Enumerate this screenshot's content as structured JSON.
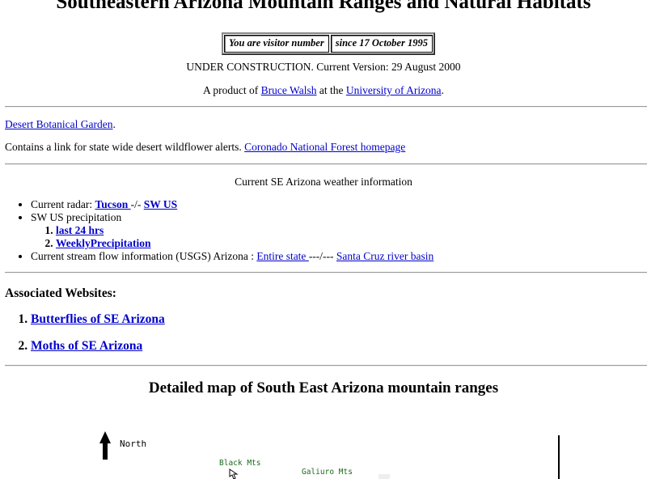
{
  "page": {
    "title": "Southeastern Arizona Mountain Ranges and Natural Habitats",
    "counter": {
      "left": "You are visitor number",
      "right": "since 17 October 1995"
    },
    "construction": "UNDER CONSTRUCTION. Current Version: 29 August 2000",
    "product": {
      "prefix": "A product of ",
      "author": "Bruce Walsh",
      "middle": " at the ",
      "org": "University of Arizona",
      "suffix": "."
    }
  },
  "links": {
    "garden": "Desert Botanical Garden",
    "garden_suffix": ".",
    "wildflower_text": "Contains a link for state wide desert wildflower alerts. ",
    "coronado": "Coronado National Forest homepage"
  },
  "weather": {
    "heading": "Current SE Arizona weather information",
    "radar_label": "Current radar: ",
    "radar_tucson": "Tucson ",
    "radar_sep": "-/- ",
    "radar_swus": "SW US",
    "precip_label": "SW US precipitation",
    "precip_items": [
      "last 24 hrs",
      "WeeklyPrecipitation"
    ],
    "stream_label": "Current stream flow information (USGS) Arizona : ",
    "stream_state": "Entire state ",
    "stream_sep": "---/--- ",
    "stream_santacruz": "Santa Cruz river basin"
  },
  "associated": {
    "heading": "Associated Websites:",
    "sites": [
      "Butterflies of SE Arizona",
      "Moths of SE Arizona"
    ]
  },
  "map": {
    "heading": "Detailed map of South East Arizona mountain ranges",
    "north_label": "North",
    "labels": [
      "Black Mts",
      "Galiuro Mts"
    ],
    "label_color": "#1a6b1a"
  }
}
